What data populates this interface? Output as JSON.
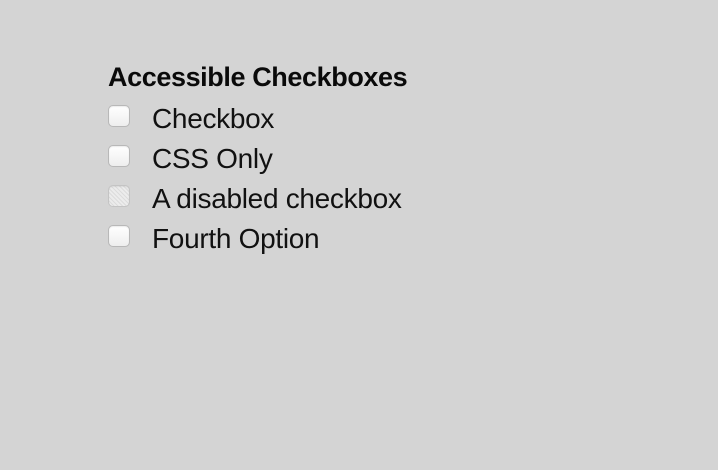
{
  "title": "Accessible Checkboxes",
  "options": [
    {
      "label": "Checkbox",
      "checked": false,
      "disabled": false
    },
    {
      "label": "CSS Only",
      "checked": false,
      "disabled": false
    },
    {
      "label": "A disabled checkbox",
      "checked": false,
      "disabled": true
    },
    {
      "label": "Fourth Option",
      "checked": false,
      "disabled": false
    }
  ],
  "colors": {
    "background": "#d4d4d4",
    "text": "#111111",
    "checkbox_border": "#b8b8b8"
  }
}
